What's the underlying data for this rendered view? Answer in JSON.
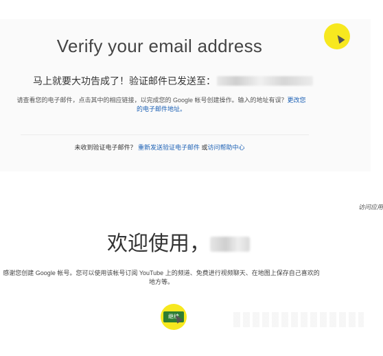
{
  "verify": {
    "title": "Verify your email address",
    "sent_text": "马上就要大功告成了！验证邮件已发送至：",
    "instructions_text": "请查看您的电子邮件，点击其中的相应链接，以完成您的 Google 帐号创建操作。输入的地址有误？",
    "change_email_link": "更改您的电子邮件地址。",
    "not_received_text": "未收到验证电子邮件？",
    "resend_link": "重新发送验证电子邮件",
    "or_text": "或",
    "help_link": "访问帮助中心"
  },
  "welcome": {
    "visit_link": "访问应用",
    "title": "欢迎使用，",
    "body": "感谢您创建 Google 帐号。您可以使用该帐号订阅 YouTube 上的频道、免费进行视频聊天、在地图上保存自己喜欢的地方等。",
    "continue_label": "继续"
  },
  "colors": {
    "highlight": "#f7e81f",
    "button": "#2e7d32",
    "link": "#1a5fb4"
  }
}
